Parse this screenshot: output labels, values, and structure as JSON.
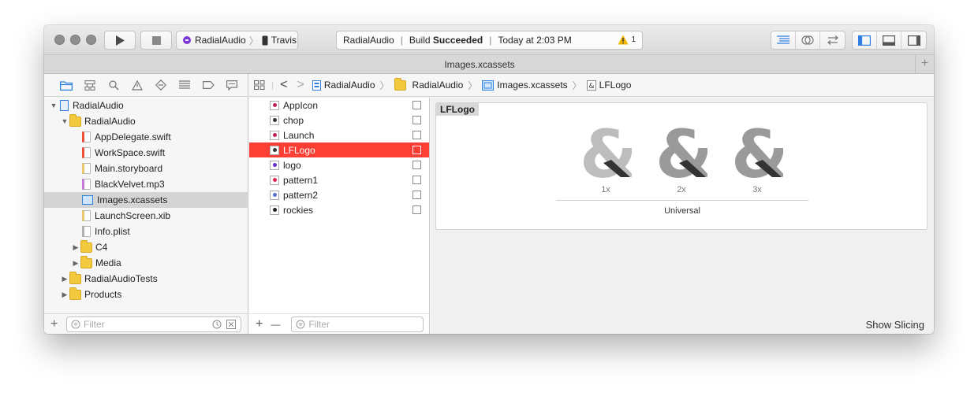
{
  "toolbar": {
    "scheme": {
      "project": "RadialAudio",
      "device": "Travis"
    },
    "status": {
      "project": "RadialAudio",
      "build_prefix": "Build",
      "build_result": "Succeeded",
      "time": "Today at 2:03 PM",
      "warning_count": "1"
    }
  },
  "tab": {
    "title": "Images.xcassets",
    "add_label": "+"
  },
  "navigator": {
    "items": [
      {
        "label": "RadialAudio",
        "depth": 0,
        "kind": "project",
        "expanded": true
      },
      {
        "label": "RadialAudio",
        "depth": 1,
        "kind": "folder",
        "expanded": true
      },
      {
        "label": "AppDelegate.swift",
        "depth": 2,
        "kind": "swift"
      },
      {
        "label": "WorkSpace.swift",
        "depth": 2,
        "kind": "swift"
      },
      {
        "label": "Main.storyboard",
        "depth": 2,
        "kind": "storyboard"
      },
      {
        "label": "BlackVelvet.mp3",
        "depth": 2,
        "kind": "audio"
      },
      {
        "label": "Images.xcassets",
        "depth": 2,
        "kind": "assets",
        "selected": true
      },
      {
        "label": "LaunchScreen.xib",
        "depth": 2,
        "kind": "xib"
      },
      {
        "label": "Info.plist",
        "depth": 2,
        "kind": "plist"
      },
      {
        "label": "C4",
        "depth": 2,
        "kind": "folder",
        "expanded": false
      },
      {
        "label": "Media",
        "depth": 2,
        "kind": "folder",
        "expanded": false
      },
      {
        "label": "RadialAudioTests",
        "depth": 1,
        "kind": "folder",
        "expanded": false
      },
      {
        "label": "Products",
        "depth": 1,
        "kind": "folder",
        "expanded": false
      }
    ],
    "filter_placeholder": "Filter"
  },
  "jumpbar": {
    "crumbs": [
      "RadialAudio",
      "RadialAudio",
      "Images.xcassets",
      "LFLogo"
    ]
  },
  "assets": {
    "items": [
      {
        "label": "AppIcon",
        "icon_color": "#c0205a"
      },
      {
        "label": "chop",
        "icon_color": "#333333"
      },
      {
        "label": "Launch",
        "icon_color": "#c0205a"
      },
      {
        "label": "LFLogo",
        "icon_color": "#333333",
        "selected": true
      },
      {
        "label": "logo",
        "icon_color": "#6a2ecf"
      },
      {
        "label": "pattern1",
        "icon_color": "#e02050"
      },
      {
        "label": "pattern2",
        "icon_color": "#5570c8"
      },
      {
        "label": "rockies",
        "icon_color": "#222222"
      }
    ],
    "filter_placeholder": "Filter",
    "add_label": "+",
    "remove_label": "—"
  },
  "editor": {
    "set_name": "LFLogo",
    "scales": [
      "1x",
      "2x",
      "3x"
    ],
    "group_label": "Universal",
    "show_slicing": "Show Slicing"
  },
  "colors": {
    "selection_red": "#fc3f34",
    "folder_yellow": "#f3c93d",
    "accent_blue": "#2f7fe0",
    "warning_yellow": "#f2b600"
  }
}
